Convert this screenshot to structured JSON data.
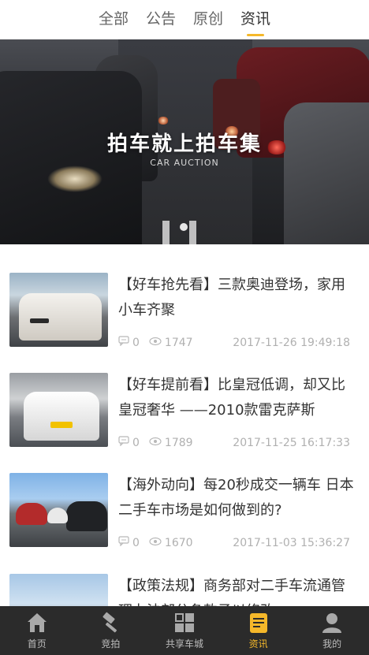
{
  "top_tabs": [
    {
      "label": "全部",
      "active": false
    },
    {
      "label": "公告",
      "active": false
    },
    {
      "label": "原创",
      "active": false
    },
    {
      "label": "资讯",
      "active": true
    }
  ],
  "banner": {
    "title": "拍车就上拍车集",
    "subtitle": "CAR AUCTION",
    "current_slide": 1,
    "total_slides": 1
  },
  "articles": [
    {
      "title": "【好车抢先看】三款奥迪登场，家用小车齐聚",
      "comments": "0",
      "views": "1747",
      "date": "2017-11-26 19:49:18"
    },
    {
      "title": "【好车提前看】比皇冠低调，却又比皇冠奢华 ——2010款雷克萨斯",
      "comments": "0",
      "views": "1789",
      "date": "2017-11-25 16:17:33"
    },
    {
      "title": "【海外动向】每20秒成交一辆车 日本二手车市场是如何做到的?",
      "comments": "0",
      "views": "1670",
      "date": "2017-11-03 15:36:27"
    },
    {
      "title": "【政策法规】商务部对二手车流通管理办法部分条款予以修改",
      "comments": "",
      "views": "",
      "date": ""
    }
  ],
  "bottom_nav": [
    {
      "label": "首页",
      "icon": "home-icon",
      "active": false
    },
    {
      "label": "竞拍",
      "icon": "gavel-icon",
      "active": false
    },
    {
      "label": "共享车城",
      "icon": "grid-icon",
      "active": false
    },
    {
      "label": "资讯",
      "icon": "news-icon",
      "active": true
    },
    {
      "label": "我的",
      "icon": "user-icon",
      "active": false
    }
  ],
  "colors": {
    "accent": "#f5b82a",
    "tabbar_bg": "#2b2b2b",
    "meta_gray": "#b0b0b0"
  }
}
